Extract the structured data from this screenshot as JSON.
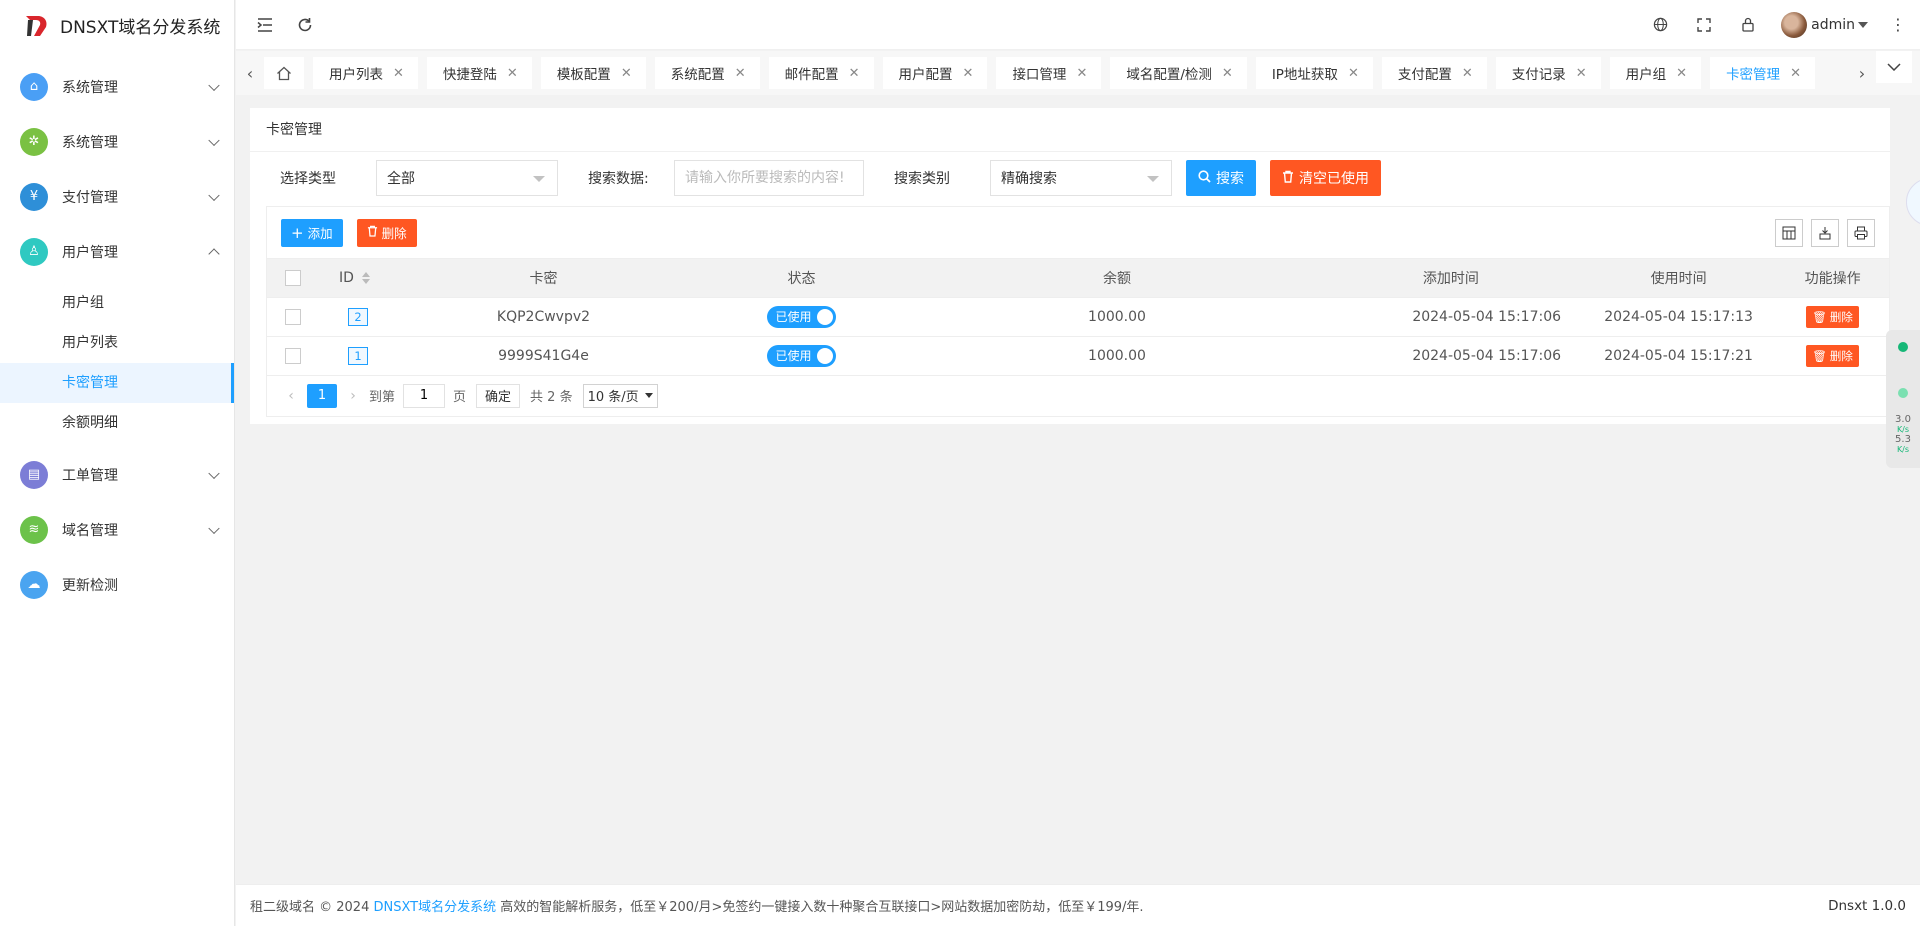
{
  "app": {
    "title": "DNSXT域名分发系统",
    "accent": "#1e9fff",
    "danger": "#ff5722"
  },
  "sidebar": {
    "menus": [
      {
        "label": "系统管理",
        "icon": "home-icon",
        "color": "#4a9ff5",
        "expanded": false
      },
      {
        "label": "系统管理",
        "icon": "gear-icon",
        "color": "#7ac143",
        "expanded": false
      },
      {
        "label": "支付管理",
        "icon": "payment-icon",
        "color": "#2e8fd8",
        "expanded": false
      },
      {
        "label": "用户管理",
        "icon": "user-icon",
        "color": "#2fc9c1",
        "expanded": true
      }
    ],
    "user_sub": [
      {
        "label": "用户组"
      },
      {
        "label": "用户列表"
      },
      {
        "label": "卡密管理",
        "active": true
      },
      {
        "label": "余额明细"
      }
    ],
    "menus_after": [
      {
        "label": "工单管理",
        "icon": "ticket-icon",
        "color": "#7c7dd6"
      },
      {
        "label": "域名管理",
        "icon": "layers-icon",
        "color": "#6cc24a"
      },
      {
        "label": "更新检测",
        "icon": "cloud-upload-icon",
        "color": "#4aa4f0"
      }
    ]
  },
  "header": {
    "user_name": "admin",
    "icons": [
      "collapse-menu-icon",
      "refresh-icon",
      "globe-icon",
      "fullscreen-icon",
      "lock-icon",
      "more-vertical-icon"
    ]
  },
  "tabs": [
    {
      "label": "用户列表"
    },
    {
      "label": "快捷登陆"
    },
    {
      "label": "模板配置"
    },
    {
      "label": "系统配置"
    },
    {
      "label": "邮件配置"
    },
    {
      "label": "用户配置"
    },
    {
      "label": "接口管理"
    },
    {
      "label": "域名配置/检测"
    },
    {
      "label": "IP地址获取"
    },
    {
      "label": "支付配置"
    },
    {
      "label": "支付记录"
    },
    {
      "label": "用户组"
    },
    {
      "label": "卡密管理",
      "active": true
    }
  ],
  "page": {
    "title": "卡密管理",
    "search": {
      "type_label": "选择类型",
      "type_value": "全部",
      "data_label": "搜索数据:",
      "data_placeholder": "请输入你所要搜索的内容!",
      "data_value": "",
      "category_label": "搜索类别",
      "category_value": "精确搜索",
      "search_btn": "搜索",
      "clear_btn": "清空已使用"
    },
    "toolbar": {
      "add_btn": "添加",
      "delete_btn": "删除"
    },
    "table": {
      "columns": [
        "ID",
        "卡密",
        "状态",
        "余额",
        "添加时间",
        "使用时间",
        "功能操作"
      ],
      "rows": [
        {
          "id": "2",
          "card": "KQP2Cwvpv2",
          "status": "已使用",
          "balance": "1000.00",
          "added": "2024-05-04 15:17:06",
          "used": "2024-05-04 15:17:13",
          "action": "删除"
        },
        {
          "id": "1",
          "card": "9999S41G4e",
          "status": "已使用",
          "balance": "1000.00",
          "added": "2024-05-04 15:17:06",
          "used": "2024-05-04 15:17:21",
          "action": "删除"
        }
      ]
    },
    "pager": {
      "current": "1",
      "goto_label": "到第",
      "goto_value": "1",
      "page_unit": "页",
      "confirm": "确定",
      "total": "共 2 条",
      "page_size": "10 条/页"
    }
  },
  "footer": {
    "prefix": "租二级域名 © 2024",
    "link": "DNSXT域名分发系统",
    "suffix": "高效的智能解析服务，低至￥200/月>免签约一键接入数十种聚合互联接口>网站数据加密防劫，低至￥199/年.",
    "version": "Dnsxt 1.0.0"
  },
  "widget": {
    "up_speed": "3.0",
    "up_unit": "K/s",
    "down_speed": "5.3",
    "down_unit": "K/s"
  }
}
